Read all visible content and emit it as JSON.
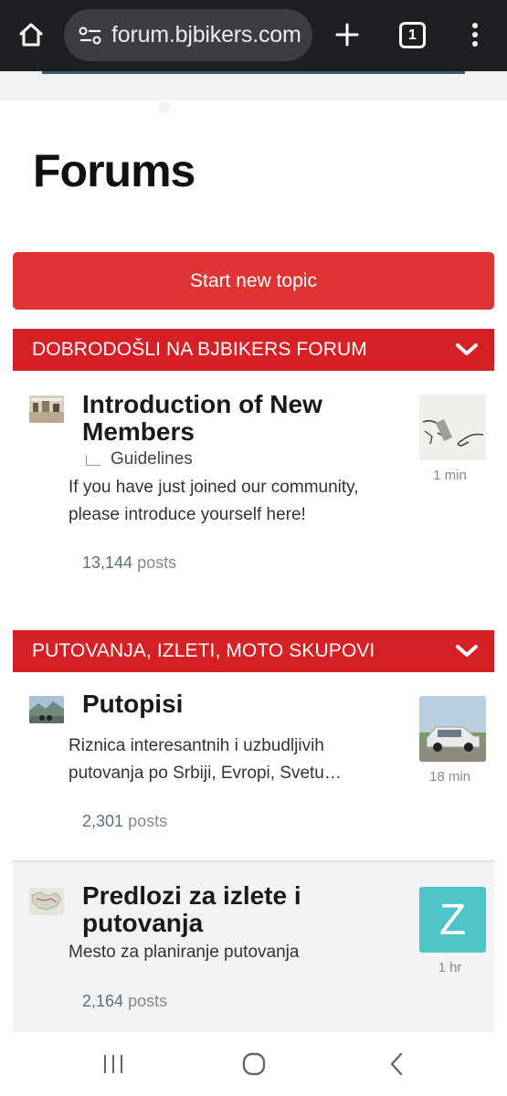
{
  "browser": {
    "url": "forum.bjbikers.com",
    "tab_count": "1",
    "icons": [
      "home-icon",
      "site-settings-icon",
      "plus-icon",
      "tabs-icon",
      "more-vert-icon"
    ]
  },
  "page": {
    "title": "Forums",
    "new_topic_label": "Start new topic"
  },
  "categories": [
    {
      "title": "DOBRODOŠLI NA BJBIKERS FORUM",
      "forums": [
        {
          "title": "Introduction of New Members",
          "subforum": "Guidelines",
          "description": "If you have just joined our community, please introduce yourself here!",
          "posts_count": "13,144",
          "posts_label": "posts",
          "last_time": "1 min"
        }
      ]
    },
    {
      "title": "PUTOVANJA, IZLETI, MOTO SKUPOVI",
      "forums": [
        {
          "title": "Putopisi",
          "description": "Riznica interesantnih i uzbudljivih putovanja po Srbiji, Evropi, Svetu…",
          "posts_count": "2,301",
          "posts_label": "posts",
          "last_time": "18 min"
        },
        {
          "title": "Predlozi za izlete i putovanja",
          "description": "Mesto za planiranje putovanja",
          "posts_count": "2,164",
          "posts_label": "posts",
          "last_time": "1 hr",
          "avatar_letter": "Z"
        }
      ]
    }
  ],
  "colors": {
    "accent": "#d71f26",
    "button": "#e03334",
    "avatar": "#4fc4c8"
  }
}
